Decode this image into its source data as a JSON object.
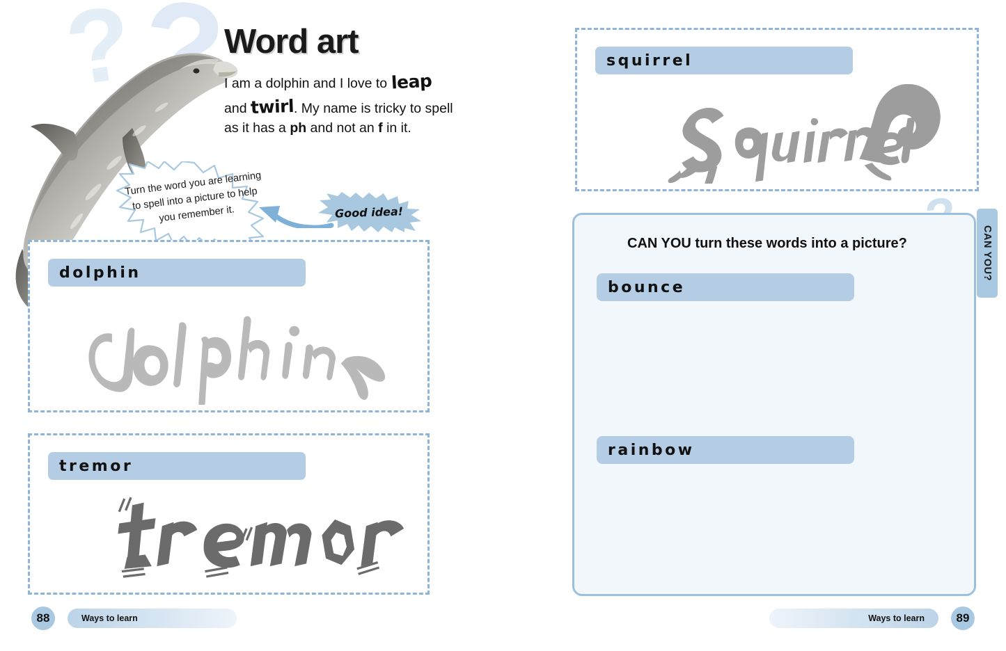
{
  "headline": {
    "title": "Word art",
    "intro_part1": "I am a dolphin and I love to ",
    "intro_leap": "leap",
    "intro_part2": "and ",
    "intro_twirl": "twirl",
    "intro_part3": ". My name is tricky to spell as it has a ",
    "intro_ph": "ph",
    "intro_part4": " and not an ",
    "intro_f": "f",
    "intro_part5": " in it."
  },
  "tip": {
    "bubble_text": "Turn the word you are learning to spell into a picture to help you remember it.",
    "reply_text": "Good idea!"
  },
  "left_words": [
    {
      "label": "dolphin",
      "art_text": "dolphin"
    },
    {
      "label": "tremor",
      "art_text": "tremor"
    }
  ],
  "right_words": [
    {
      "label": "squirrel",
      "art_text": "squirrel"
    }
  ],
  "canyou": {
    "tab_label": "CAN YOU?",
    "title": "CAN YOU turn these words into a picture?",
    "words": [
      {
        "label": "bounce"
      },
      {
        "label": "rainbow"
      }
    ]
  },
  "footers": {
    "left": {
      "page": "88",
      "section": "Ways to learn"
    },
    "right": {
      "page": "89",
      "section": "Ways to learn"
    }
  },
  "colors": {
    "label_bar": "#b4cde4",
    "dashed_border": "#8fb4d9",
    "panel_border": "#9cc0dd",
    "panel_fill": "#f2f7fc",
    "tab": "#a9c9e3",
    "burst_fill": "#a8c8e0",
    "word_art_gray": "#b3b3b3",
    "tremor_gray": "#6b6b6b",
    "bg_question": "#e4eef7"
  },
  "icons": {
    "dolphin": "dolphin-photo",
    "question_mark": "question-mark-icon",
    "arrow": "curved-arrow-icon"
  }
}
